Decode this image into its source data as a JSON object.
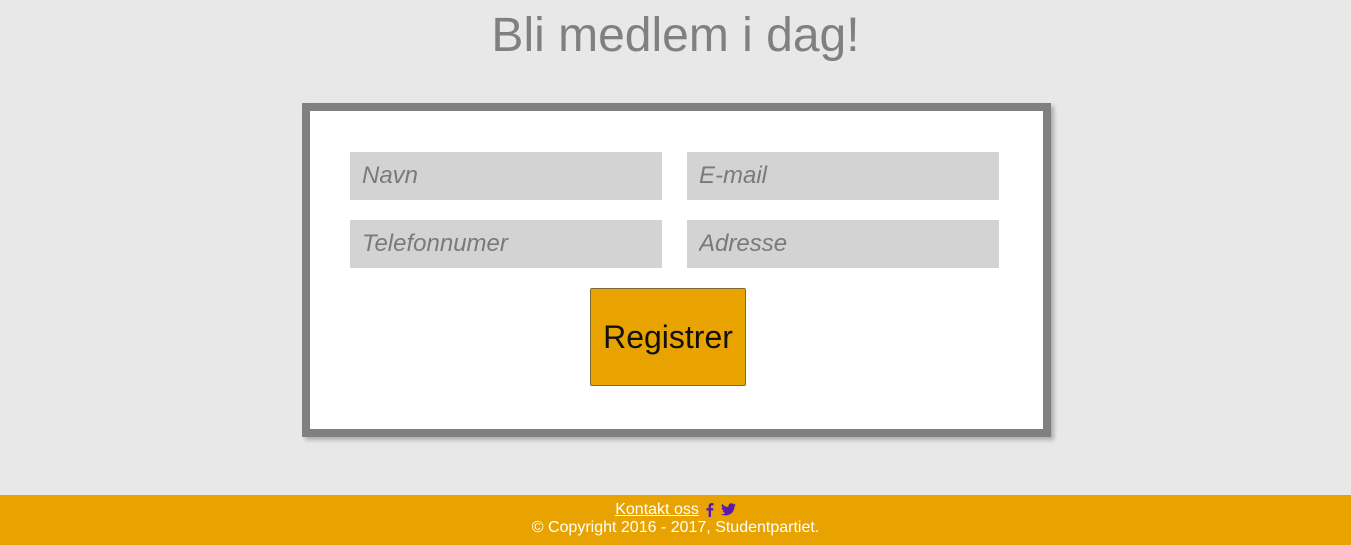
{
  "page": {
    "title": "Bli medlem i dag!"
  },
  "form": {
    "name_placeholder": "Navn",
    "email_placeholder": "E-mail",
    "phone_placeholder": "Telefonnumer",
    "address_placeholder": "Adresse",
    "submit_label": "Registrer"
  },
  "footer": {
    "contact_label": "Kontakt oss",
    "copyright": "© Copyright 2016 - 2017, Studentpartiet.",
    "icons": [
      "facebook-icon",
      "twitter-icon"
    ]
  },
  "colors": {
    "background": "#e8e8e8",
    "accent": "#e8a300",
    "card_border": "#808080",
    "field_background": "#d3d3d3",
    "social_icon": "#5a1ab0"
  }
}
